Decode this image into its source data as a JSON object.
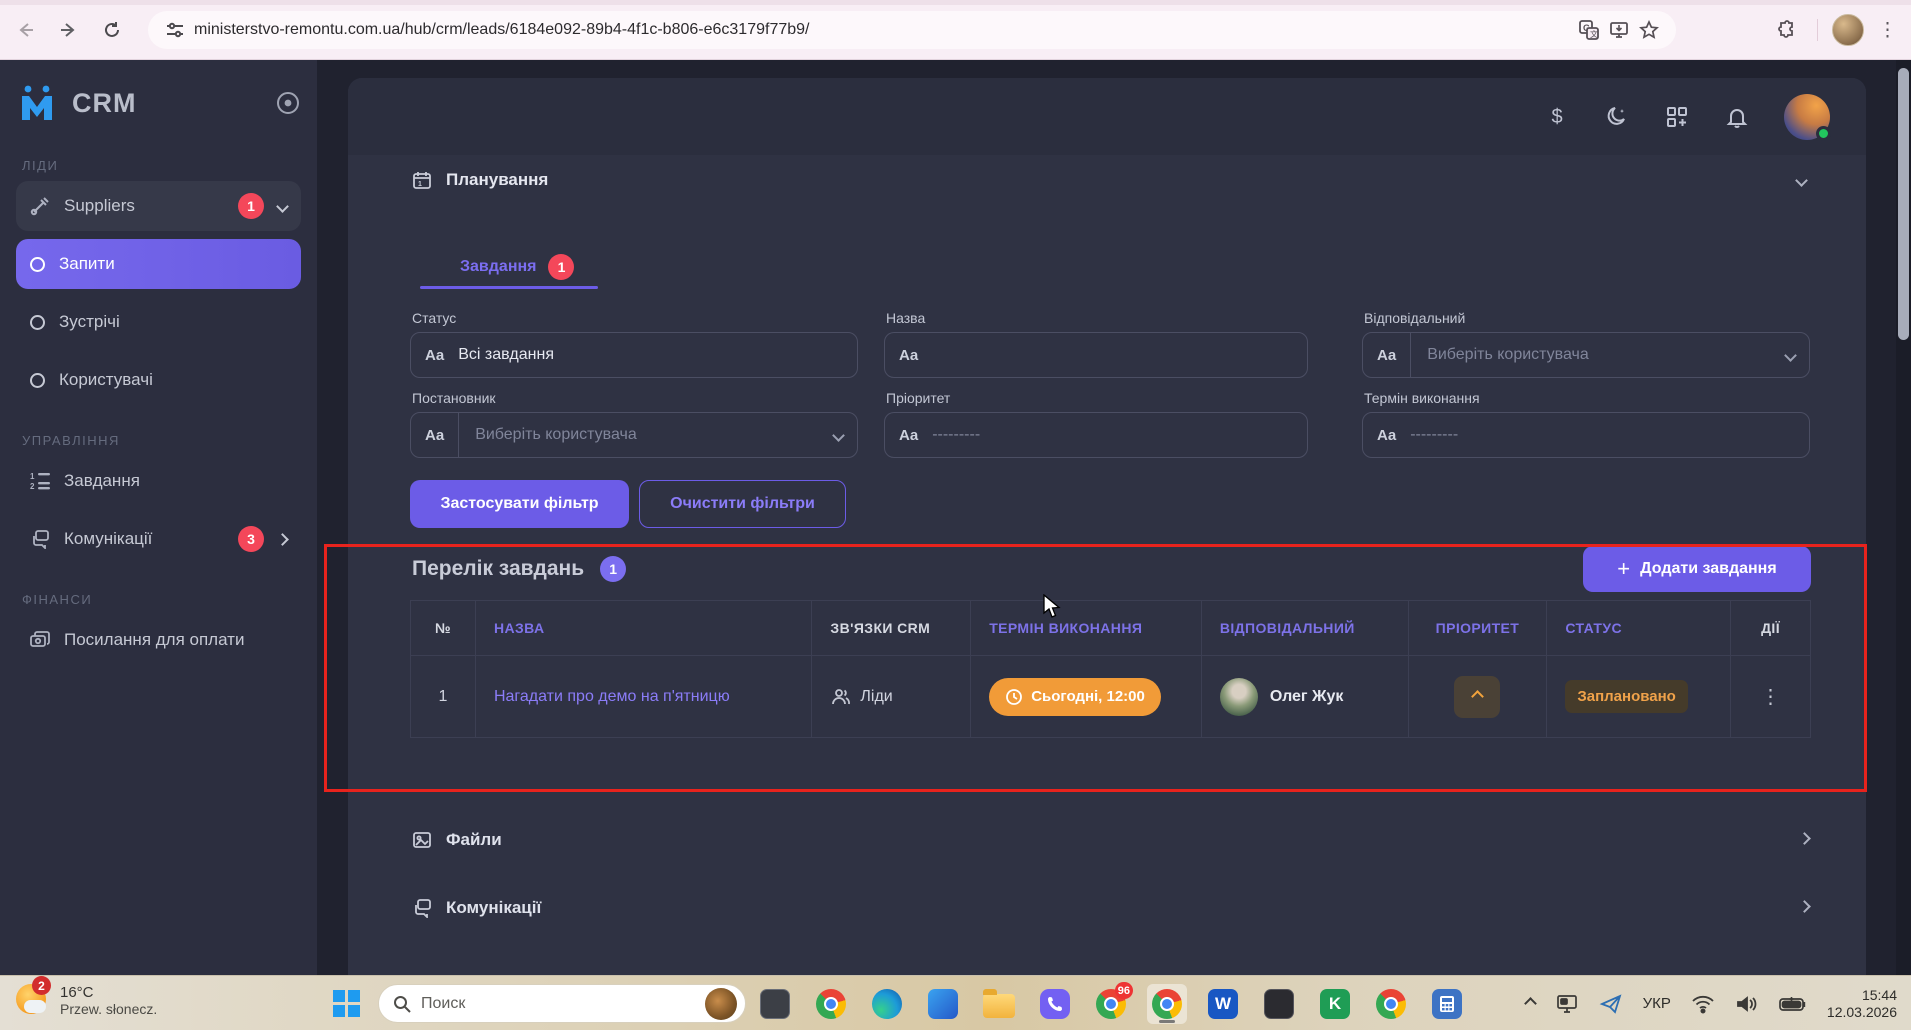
{
  "browser": {
    "url": "ministerstvo-remontu.com.ua/hub/crm/leads/6184e092-89b4-4f1c-b806-e6c3179f77b9/",
    "menu_glyph": "⋮"
  },
  "sidebar": {
    "logo": "CRM",
    "group_leads": "ЛІДИ",
    "group_management": "УПРАВЛІННЯ",
    "group_finance": "ФІНАНСИ",
    "suppliers": {
      "label": "Suppliers",
      "badge": "1"
    },
    "requests": {
      "label": "Запити"
    },
    "meetings": {
      "label": "Зустрічі"
    },
    "users": {
      "label": "Користувачі"
    },
    "tasks": {
      "label": "Завдання"
    },
    "communications": {
      "label": "Комунікації",
      "badge": "3"
    },
    "payment_links": {
      "label": "Посилання для оплати"
    }
  },
  "header": {
    "dollar": "$"
  },
  "planning": {
    "title": "Планування",
    "tab": {
      "label": "Завдання",
      "badge": "1"
    },
    "filters": [
      {
        "label": "Статус",
        "value": "Всі завдання"
      },
      {
        "label": "Назва",
        "value": ""
      },
      {
        "label": "Відповідальний",
        "placeholder": "Виберіть користувача"
      },
      {
        "label": "Постановник",
        "placeholder": "Виберіть користувача"
      },
      {
        "label": "Пріоритет",
        "placeholder": "---------"
      },
      {
        "label": "Термін виконання",
        "placeholder": "---------"
      }
    ],
    "aa": "Aa",
    "apply_label": "Застосувати фільтр",
    "clear_label": "Очистити фільтри"
  },
  "tasks": {
    "title": "Перелік завдань",
    "badge": "1",
    "add_label": "Додати завдання",
    "add_plus": "+",
    "columns": [
      "№",
      "НАЗВА",
      "ЗВ'ЯЗКИ CRM",
      "ТЕРМІН ВИКОНАННЯ",
      "ВІДПОВІДАЛЬНИЙ",
      "ПРІОРИТЕТ",
      "СТАТУС",
      "ДІЇ"
    ],
    "row": {
      "num": "1",
      "name": "Нагадати про демо на п'ятницю",
      "crm": "Ліди",
      "due": "Сьогодні, 12:00",
      "assignee": "Олег Жук",
      "status": "Заплановано",
      "actions_glyph": "⋮"
    }
  },
  "sections": {
    "files": "Файли",
    "communications": "Комунікації"
  },
  "taskbar": {
    "weather_badge": "2",
    "temperature": "16°C",
    "condition": "Przew. słonecz.",
    "search_placeholder": "Поиск",
    "chrome_badge": "96",
    "word_glyph": "W",
    "green_glyph": "K",
    "lang": "УКР",
    "time": "15:44",
    "date": "12.03.2026"
  },
  "colors": {
    "accent_purple": "#6c5ce7",
    "danger_red": "#f4475a",
    "warning_orange": "#f19b38",
    "annotation_red": "#e8231d"
  }
}
